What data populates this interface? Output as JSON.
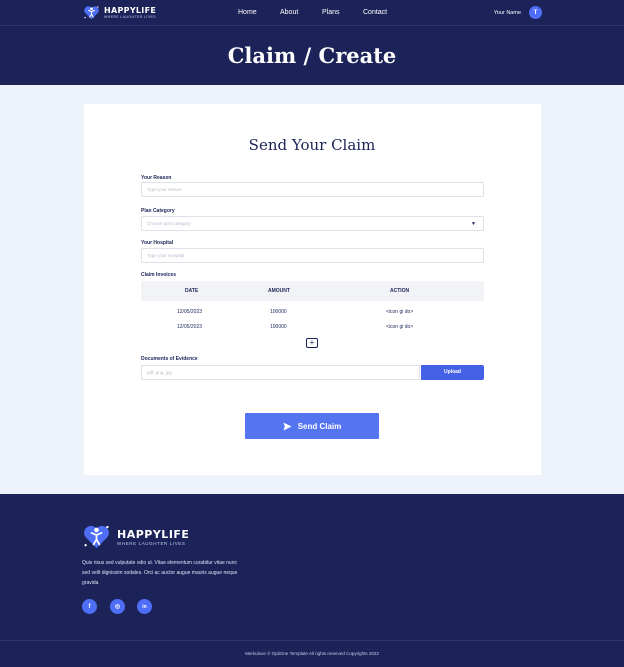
{
  "header": {
    "brand": "HAPPYLIFE",
    "tagline": "WHERE LAUGHTER LIVES",
    "nav": [
      "Home",
      "About",
      "Plans",
      "Contact"
    ],
    "user_name": "Your Name",
    "avatar_initial": "T"
  },
  "hero": {
    "title": "Claim / Create"
  },
  "form": {
    "title": "Send Your Claim",
    "reason_label": "Your Reason",
    "reason_placeholder": "Type your reason",
    "category_label": "Plan Category",
    "category_placeholder": "Choose plan category",
    "hospital_label": "Your Hospital",
    "hospital_placeholder": "Type your Hospital",
    "invoices_label": "Claim Invoices",
    "invoice_headers": [
      "DATE",
      "AMOUNT",
      "ACTION"
    ],
    "invoice_rows": [
      {
        "date": "12/05/2023",
        "amount": "100000",
        "action": "<icon gi do>"
      },
      {
        "date": "12/05/2023",
        "amount": "100000",
        "action": "<icon gi do>"
      }
    ],
    "add_row_label": "+",
    "evidence_label": "Documents of Evidence",
    "evidence_placeholder": "pdf, png, jpg",
    "upload_label": "Upload",
    "submit_label": "Send Claim"
  },
  "footer": {
    "brand": "HAPPYLIFE",
    "tagline": "WHERE LAUGHTER LIVES",
    "description": "Quis risus sed vulputate odio ut. Vitae elementum curabitur vitae nunc sed velit dignissim sodales. Orci ac auctor augue mauris augue neque gravida",
    "social": [
      {
        "name": "facebook-icon",
        "glyph": "f"
      },
      {
        "name": "instagram-icon",
        "glyph": "◎"
      },
      {
        "name": "linkedin-icon",
        "glyph": "in"
      }
    ],
    "copyright": "Merkulove © OptiOne Template All rights reserved Copyrights 2022"
  },
  "colors": {
    "navy": "#1b2358",
    "accent": "#4f6ef7",
    "page_bg": "#eef2fb"
  }
}
